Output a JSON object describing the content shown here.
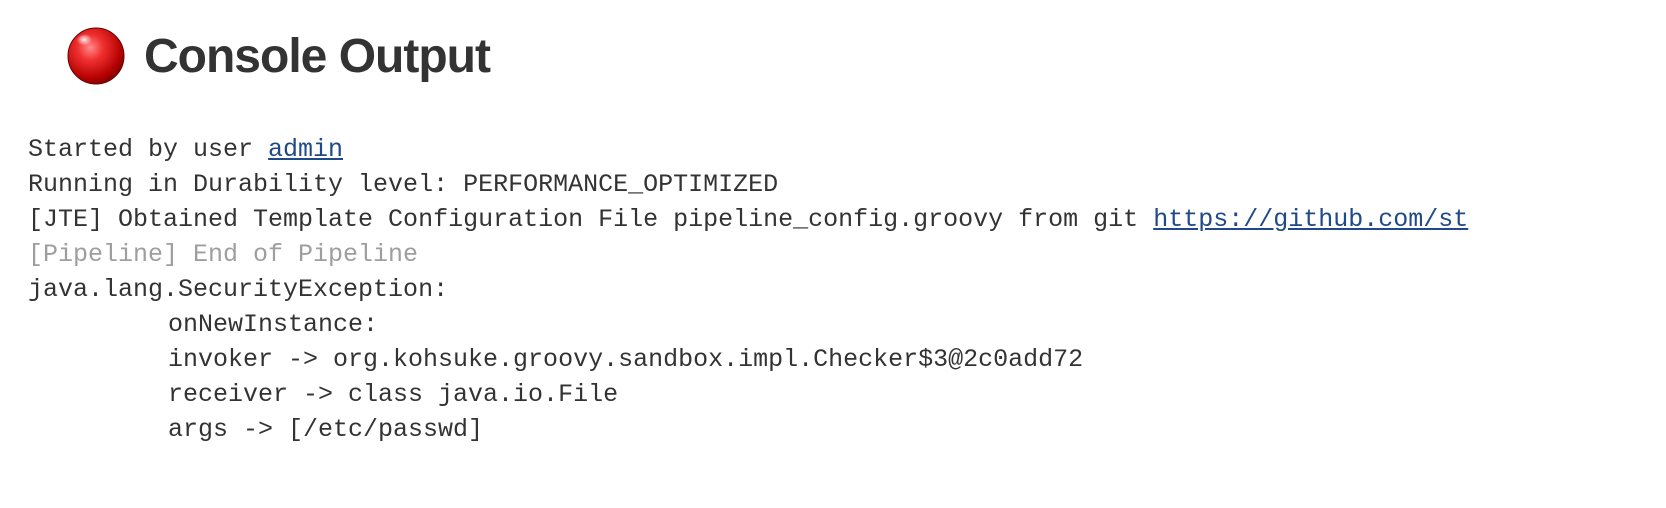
{
  "header": {
    "title": "Console Output",
    "status": "failure"
  },
  "console": {
    "startedBy": {
      "prefix": "Started by user ",
      "userLink": "admin"
    },
    "durability": "Running in Durability level: PERFORMANCE_OPTIMIZED",
    "jteLine": {
      "prefix": "[JTE] Obtained Template Configuration File pipeline_config.groovy from git ",
      "url": "https://github.com/st"
    },
    "pipelineEnd": "[Pipeline] End of Pipeline",
    "exception": {
      "head": "java.lang.SecurityException: ",
      "l1": "onNewInstance: ",
      "l2": "invoker -> org.kohsuke.groovy.sandbox.impl.Checker$3@2c0add72",
      "l3": "receiver -> class java.io.File",
      "l4": "args -> [/etc/passwd]"
    }
  }
}
